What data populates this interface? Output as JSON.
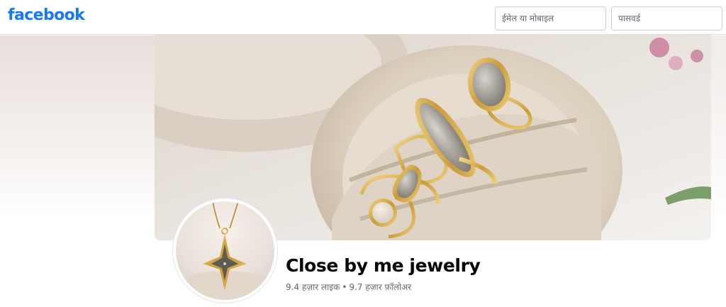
{
  "header": {
    "logo_text": "facebook",
    "email_placeholder": "ईमेल या मोबाइल",
    "password_placeholder": "पासवर्ड",
    "brand_color": "#1877f2"
  },
  "page": {
    "name": "Close by me jewelry",
    "likes": "9.4 हज़ार लाइक",
    "separator": "•",
    "followers": "9.7 हज़ार फ़ॉलोअर"
  },
  "icons": {
    "cover": "cover-photo-rings",
    "profile": "profile-pendant-star"
  }
}
